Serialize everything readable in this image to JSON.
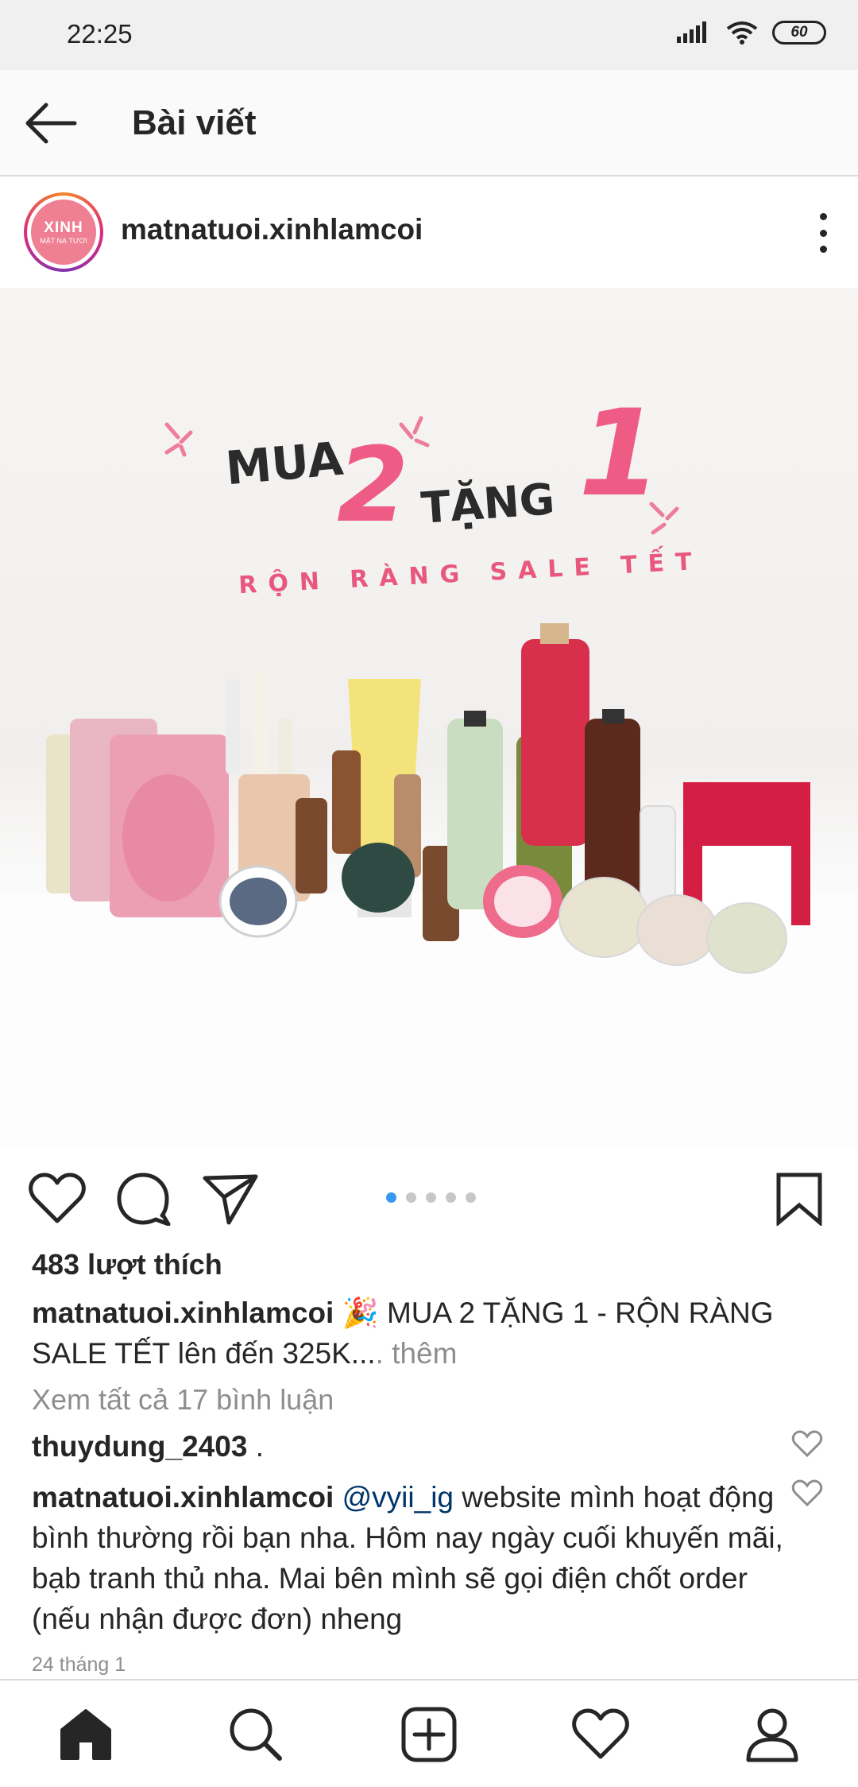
{
  "status_bar": {
    "time": "22:25",
    "battery": "60"
  },
  "header": {
    "title": "Bài viết"
  },
  "post": {
    "username": "matnatuoi.xinhlamcoi",
    "avatar": {
      "logo": "XINH",
      "sub": "MẶT NẠ TƯƠI"
    },
    "image": {
      "word_mua": "MUA",
      "num_2": "2",
      "word_tang": "TẶNG",
      "num_1": "1",
      "subtitle": "RỘN RÀNG SALE TẾT"
    },
    "carousel": {
      "count": 5,
      "active": 0
    },
    "likes": "483 lượt thích",
    "caption": {
      "username": "matnatuoi.xinhlamcoi",
      "emoji": "🎉",
      "text": "MUA 2 TẶNG 1 - RỘN RÀNG SALE TẾT lên đến 325K...",
      "more": ". thêm"
    },
    "view_all_comments": "Xem tất cả 17 bình luận",
    "comments": [
      {
        "username": "thuydung_2403",
        "text": "."
      },
      {
        "username": "matnatuoi.xinhlamcoi",
        "mention": "@vyii_ig",
        "text": "website mình hoạt động bình thường rồi bạn nha. Hôm nay ngày cuối khuyến mãi, bạb tranh thủ nha. Mai bên mình sẽ gọi điện chốt order (nếu nhận được đơn) nheng"
      }
    ],
    "timestamp": "24 tháng 1"
  },
  "colors": {
    "accent_pink": "#ee5c86",
    "link_blue": "#003569",
    "dot_active": "#3897f0"
  },
  "icons": {
    "action_bar": [
      "heart-icon",
      "comment-icon",
      "share-icon",
      "bookmark-icon"
    ],
    "bottom_nav": [
      "home-icon",
      "search-icon",
      "add-post-icon",
      "activity-heart-icon",
      "profile-icon"
    ]
  }
}
